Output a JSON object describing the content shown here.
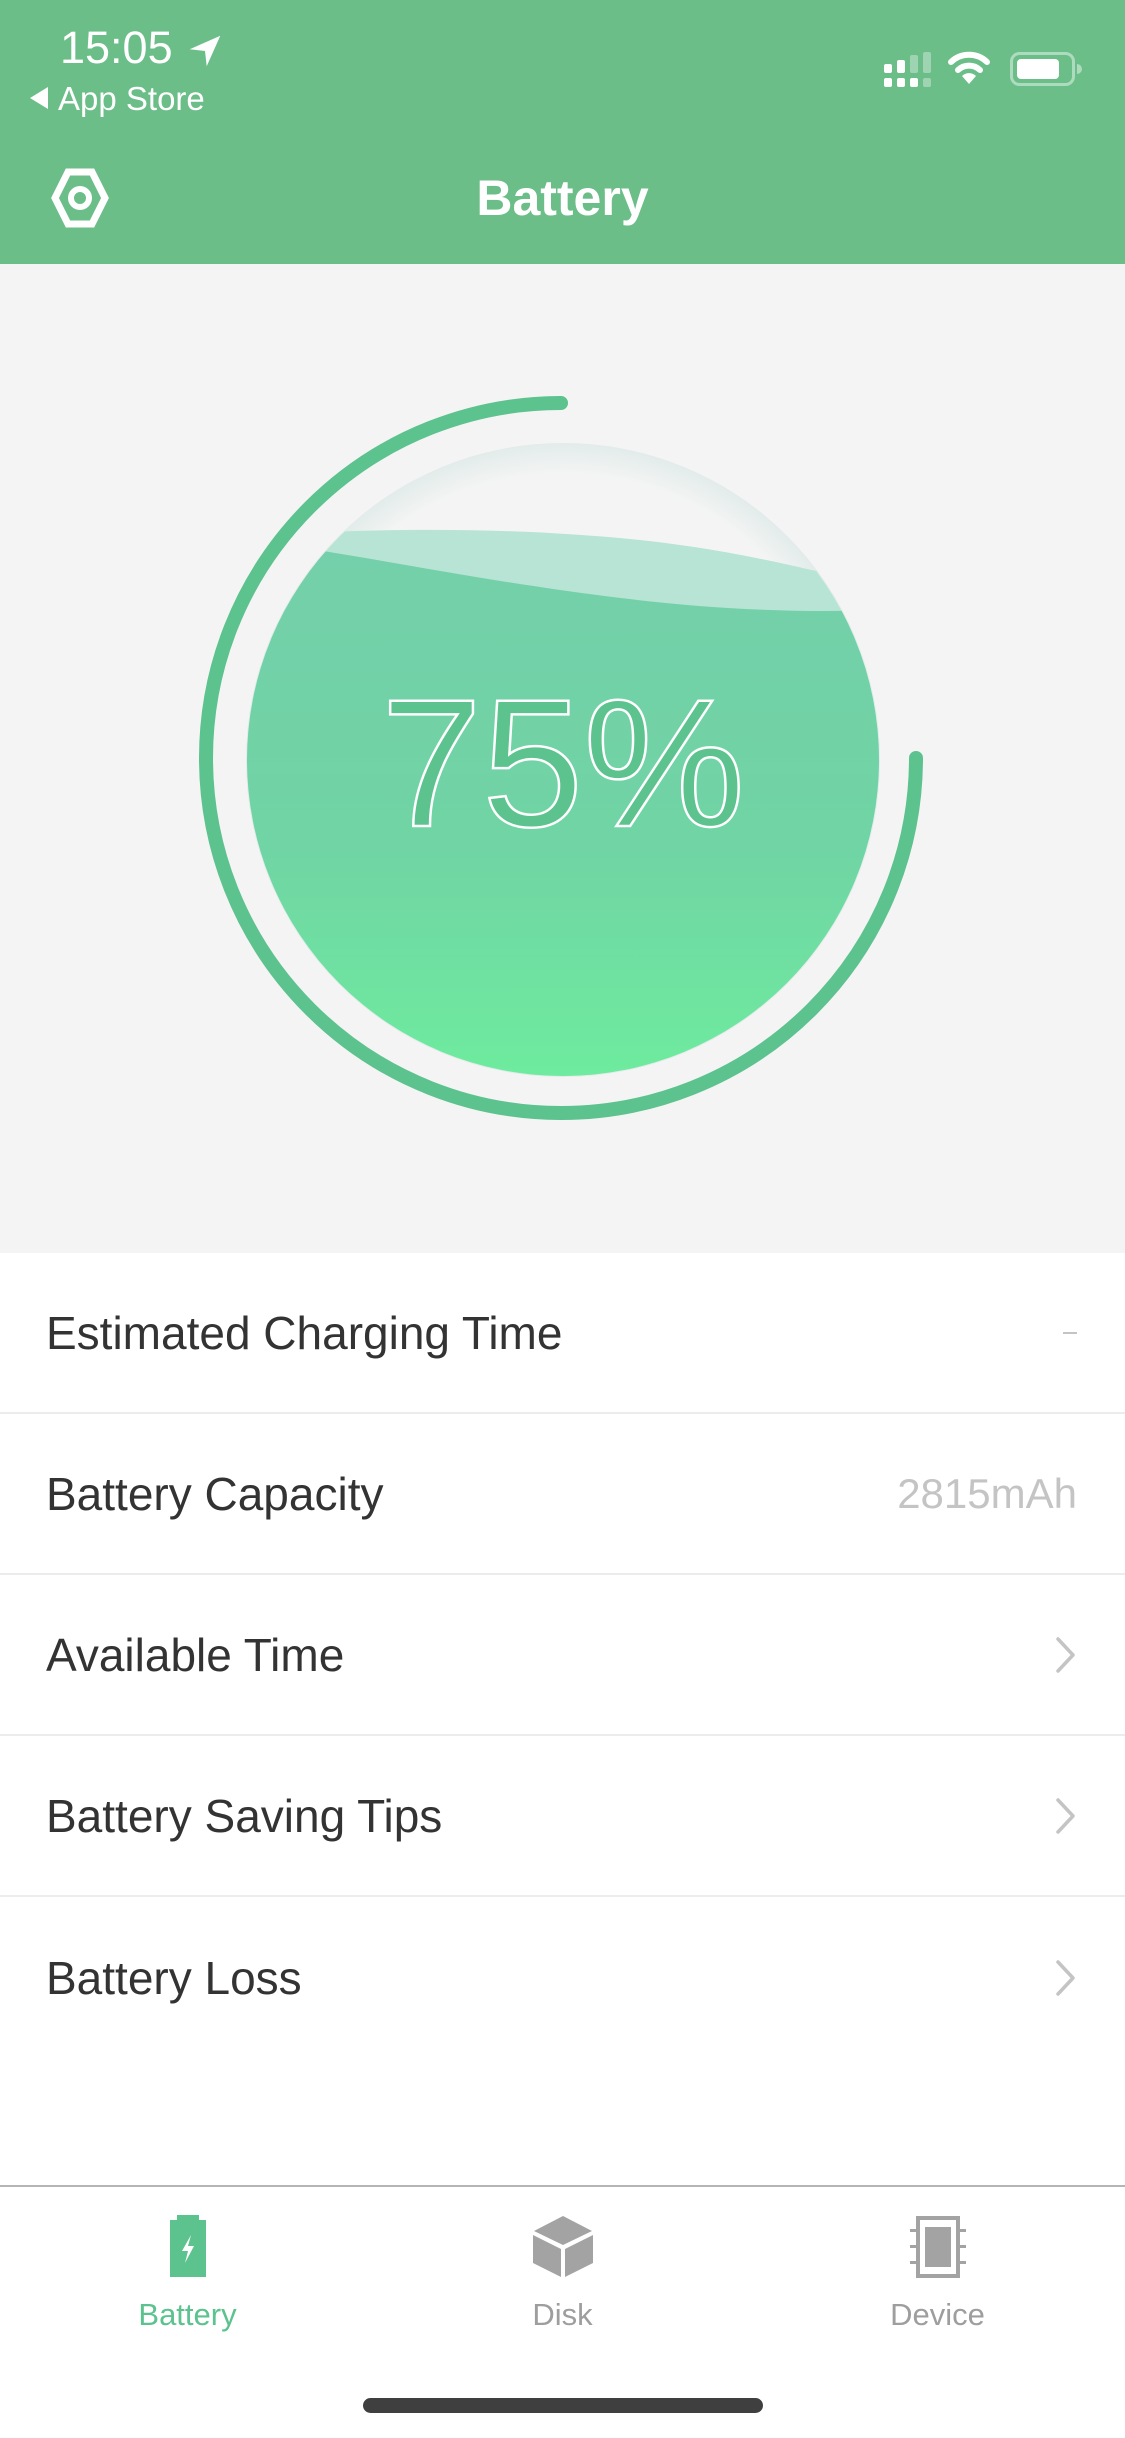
{
  "status_bar": {
    "time": "15:05",
    "back_label": "App Store",
    "icons": [
      "location-arrow-icon",
      "cellular-signal-icon",
      "wifi-icon",
      "battery-status-icon"
    ]
  },
  "header": {
    "title": "Battery",
    "settings_icon": "hexagon-settings-icon"
  },
  "gauge": {
    "percent_label": "75%",
    "level_percent": 75
  },
  "list": {
    "rows": [
      {
        "label": "Estimated Charging Time",
        "value": "-",
        "type": "value"
      },
      {
        "label": "Battery Capacity",
        "value": "2815mAh",
        "type": "value"
      },
      {
        "label": "Available Time",
        "type": "link"
      },
      {
        "label": "Battery Saving Tips",
        "type": "link"
      },
      {
        "label": "Battery Loss",
        "type": "link"
      }
    ]
  },
  "tabbar": {
    "tabs": [
      {
        "label": "Battery",
        "icon": "battery-charging-icon",
        "active": true
      },
      {
        "label": "Disk",
        "icon": "cube-disk-icon",
        "active": false
      },
      {
        "label": "Device",
        "icon": "chip-device-icon",
        "active": false
      }
    ]
  },
  "colors": {
    "brand": "#6bbe88",
    "accent": "#5cc28e",
    "active_tab": "#5cc28e",
    "inactive_tab": "#9e9e9e",
    "background": "#f4f4f4"
  }
}
